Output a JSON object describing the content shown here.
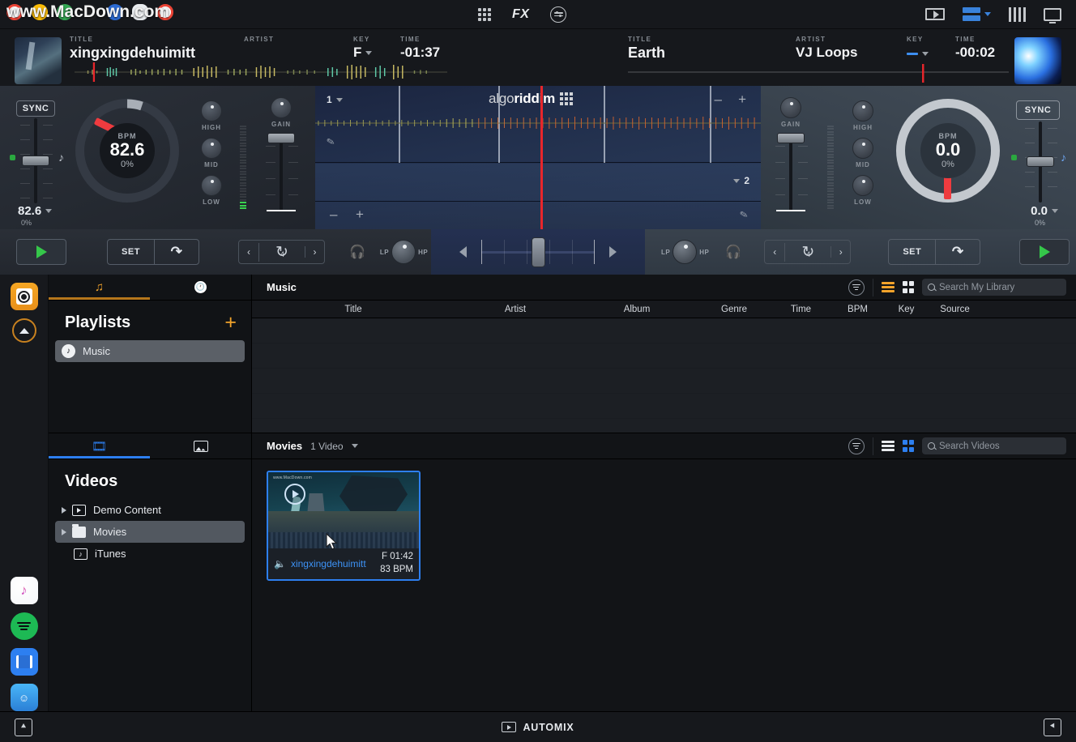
{
  "watermark": "www.MacDown.com",
  "toolbar": {
    "grid_icon": "grid-apps-icon",
    "fx_label": "FX",
    "eq_icon": "mixer-circle-icon",
    "video_icon": "video-preview-icon",
    "layout_icon": "layout-selector-icon",
    "bars_icon": "vertical-bars-icon",
    "monitor_icon": "external-display-icon"
  },
  "logo": {
    "text_light": "algo",
    "text_bold": "riddim"
  },
  "decks": {
    "left": {
      "labels": {
        "title": "TITLE",
        "artist": "ARTIST",
        "key": "KEY",
        "time": "TIME"
      },
      "title": "xingxingdehuimitt",
      "artist": "",
      "key": "F",
      "time": "-01:37",
      "sync": "SYNC",
      "bpm_label": "BPM",
      "bpm": "82.6",
      "bpm_pct": "0%",
      "pitch_value": "82.6",
      "pitch_pct": "0%",
      "eq": [
        "HIGH",
        "MID",
        "LOW"
      ],
      "gain_label": "GAIN",
      "set_label": "SET",
      "loop_beats": "4",
      "filter_low": "LP",
      "filter_high": "HP"
    },
    "right": {
      "labels": {
        "title": "TITLE",
        "artist": "ARTIST",
        "key": "KEY",
        "time": "TIME"
      },
      "title": "Earth",
      "artist": "VJ Loops",
      "key": "",
      "time": "-00:02",
      "sync": "SYNC",
      "bpm_label": "BPM",
      "bpm": "0.0",
      "bpm_pct": "0%",
      "pitch_value": "0.0",
      "pitch_pct": "0%",
      "eq": [
        "HIGH",
        "MID",
        "LOW"
      ],
      "gain_label": "GAIN",
      "set_label": "SET",
      "loop_beats": "4",
      "filter_low": "LP",
      "filter_high": "HP"
    }
  },
  "waveform": {
    "deck_one": "1",
    "deck_two": "2",
    "zoom_out": "–",
    "zoom_in": "+"
  },
  "rail": {
    "library_icon": "music-library-icon",
    "collapse_icon": "collapse-chevron-icon",
    "itunes_icon": "itunes-icon",
    "spotify_icon": "spotify-icon",
    "video_icon": "video-library-icon",
    "finder_icon": "finder-icon"
  },
  "music_panel": {
    "tab_playlists_icon": "playlist-note-icon",
    "tab_history_icon": "history-clock-icon",
    "heading": "Playlists",
    "add_label": "+",
    "items": [
      {
        "label": "Music",
        "icon": "apple-music-icon",
        "selected": true
      }
    ],
    "content_title": "Music",
    "filter_icon": "filter-icon",
    "list_view_icon": "list-view-icon",
    "grid_view_icon": "grid-view-icon",
    "search_placeholder": "Search My Library",
    "columns": [
      "Title",
      "Artist",
      "Album",
      "Genre",
      "Time",
      "BPM",
      "Key",
      "Source"
    ],
    "rows": []
  },
  "video_panel": {
    "tab_videos_icon": "film-strip-icon",
    "tab_photos_icon": "photo-icon",
    "heading": "Videos",
    "items": [
      {
        "label": "Demo Content",
        "icon": "video-folder-icon",
        "selected": false,
        "expandable": true
      },
      {
        "label": "Movies",
        "icon": "folder-icon",
        "selected": true,
        "expandable": true
      },
      {
        "label": "iTunes",
        "icon": "itunes-note-icon",
        "selected": false,
        "expandable": false
      }
    ],
    "content_title": "Movies",
    "content_count": "1 Video",
    "filter_icon": "filter-icon",
    "list_view_icon": "list-view-icon",
    "grid_view_icon": "grid-view-icon",
    "search_placeholder": "Search Videos",
    "videos": [
      {
        "name": "xingxingdehuimitt",
        "key": "F",
        "duration": "01:42",
        "bpm": "83 BPM",
        "thumb_watermark": "www.MacDown.com",
        "selected": true
      }
    ]
  },
  "bottom_bar": {
    "automix_label": "AUTOMIX",
    "automix_icon": "automix-icon",
    "left_icon": "load-panel-icon",
    "right_icon": "right-panel-icon"
  },
  "colors": {
    "accent_orange": "#f2a32b",
    "accent_blue": "#2d7ff0",
    "play_green": "#35c74a",
    "playhead_red": "#e8262b"
  }
}
